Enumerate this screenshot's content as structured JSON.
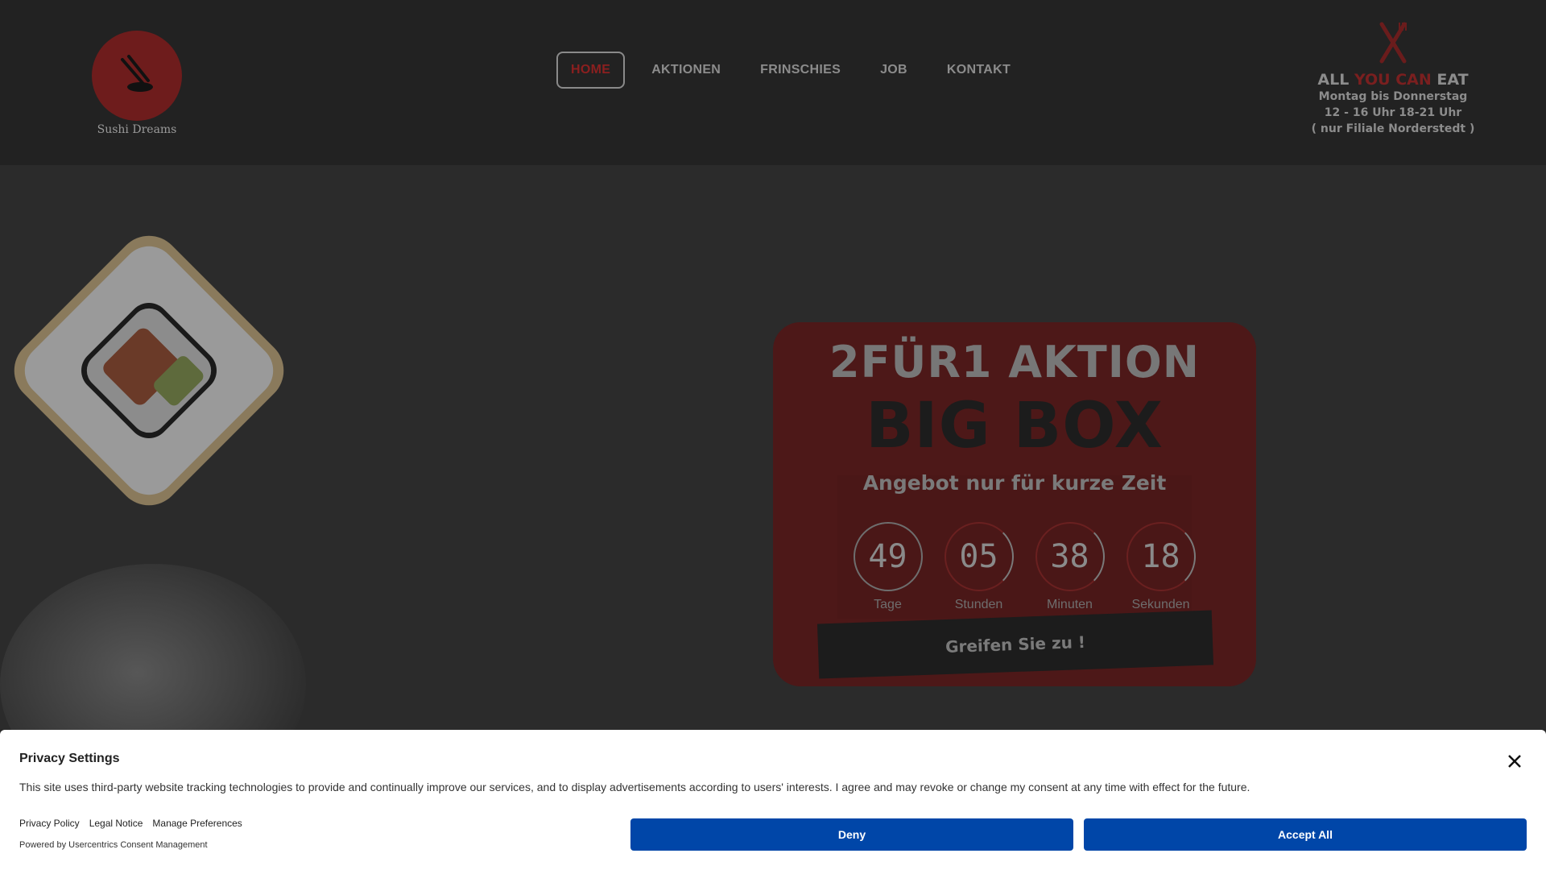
{
  "header": {
    "logo_text": "Sushi Dreams",
    "nav": [
      {
        "label": "HOME",
        "active": true
      },
      {
        "label": "AKTIONEN",
        "active": false
      },
      {
        "label": "FRINSCHIES",
        "active": false
      },
      {
        "label": "JOB",
        "active": false
      },
      {
        "label": "KONTAKT",
        "active": false
      }
    ],
    "ayce": {
      "title_part1": "ALL",
      "title_part2": "YOU CAN",
      "title_part3": "EAT",
      "line1": "Montag bis Donnerstag",
      "line2": "12 - 16 Uhr  18-21 Uhr",
      "line3": "( nur Filiale Norderstedt )"
    }
  },
  "promo": {
    "title": "2FÜR1 AKTION",
    "big": "BIG BOX",
    "subtitle": "Angebot nur für kurze Zeit",
    "countdown": [
      {
        "value": "49",
        "label": "Tage"
      },
      {
        "value": "05",
        "label": "Stunden"
      },
      {
        "value": "38",
        "label": "Minuten"
      },
      {
        "value": "18",
        "label": "Sekunden"
      }
    ],
    "cta": "Greifen Sie zu !"
  },
  "cookie": {
    "title": "Privacy Settings",
    "text": "This site uses third-party website tracking technologies to provide and continually improve our services, and to display advertisements according to users' interests. I agree and may revoke or change my consent at any time with effect for the future.",
    "links": [
      "Privacy Policy",
      "Legal Notice",
      "Manage Preferences"
    ],
    "powered": "Powered by Usercentrics Consent Management",
    "deny": "Deny",
    "accept": "Accept All"
  },
  "colors": {
    "accent_red": "#8c1f1f",
    "button_blue": "#0046a8"
  }
}
